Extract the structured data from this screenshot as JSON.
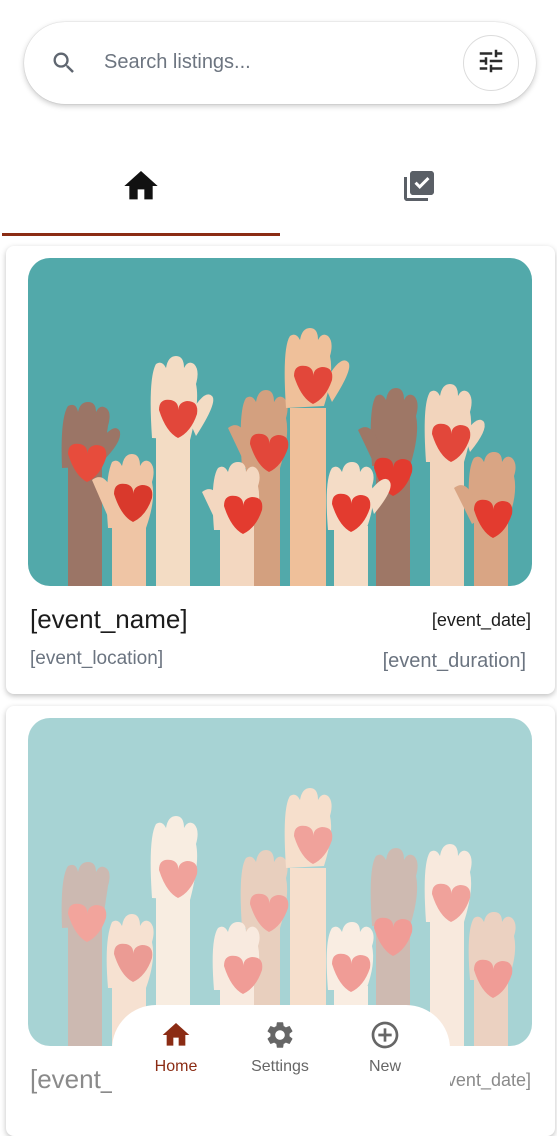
{
  "search": {
    "placeholder": "Search listings..."
  },
  "icons": {
    "search": "search-icon",
    "filter": "tune-icon",
    "home_tab": "home-icon",
    "done_tab": "library-add-check-icon",
    "nav_home": "home-icon",
    "nav_settings": "gear-icon",
    "nav_new": "add-circle-icon"
  },
  "colors": {
    "accent": "#8b2c14",
    "image_bg": "#52a9aa"
  },
  "listings": [
    {
      "name": "[event_name]",
      "date": "[event_date]",
      "location": "[event_location]",
      "duration": "[event_duration]"
    },
    {
      "name": "[event_name]",
      "date": "[event_date]"
    }
  ],
  "bottom_nav": {
    "home_label": "Home",
    "settings_label": "Settings",
    "new_label": "New"
  }
}
